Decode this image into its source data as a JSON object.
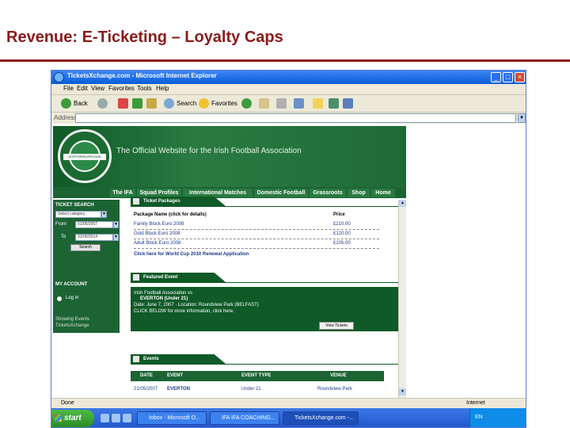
{
  "slide": {
    "title": "Revenue: E-Ticketing – Loyalty Caps"
  },
  "window": {
    "title": "TicketsXchange.com - Microsoft Internet Explorer",
    "buttons": [
      "_",
      "□",
      "×"
    ]
  },
  "menu": [
    "File",
    "Edit",
    "View",
    "Favorites",
    "Tools",
    "Help"
  ],
  "toolbar": {
    "back": "Back",
    "search": "Search",
    "favorites": "Favorites"
  },
  "address": {
    "label": "Address",
    "go": "▼"
  },
  "site": {
    "crest_text": "NORTHERN IRELAND",
    "hero_title": "The Official Website for the Irish Football Association",
    "nav": [
      "The IFA",
      "Squad Profiles",
      "International Matches",
      "Domestic Football",
      "Grassroots",
      "Shop",
      "Home"
    ]
  },
  "sidebar": {
    "ticket_search": "TICKET SEARCH",
    "category": "Select category",
    "from_label": "From",
    "from_value": "01/05/2007",
    "to_label": "To",
    "to_value": "31/05/2014",
    "search_btn": "Search",
    "my_account": "MY ACCOUNT",
    "login": "Log in",
    "footer1": "Showing Events",
    "footer2": "TicketsXchange"
  },
  "packages": {
    "header": "Ticket Packages",
    "col_name": "Package Name (click for details)",
    "col_price": "Price",
    "rows": [
      {
        "name": "Family Block Euro 2008",
        "price": "£210.00"
      },
      {
        "name": "Gold Block Euro 2008",
        "price": "£120.00"
      },
      {
        "name": "Adult Block Euro 2008",
        "price": "£105.00"
      }
    ],
    "link": "Click here for World Cup 2010 Renewal Application"
  },
  "featured": {
    "header": "Featured Event",
    "line1": "Irish Football Association vs",
    "line2": "EVERTON (Under 21)",
    "line3": "Date: June 7, 2007 · Location: Roundview Park (BELFAST)",
    "line4": "CLICK BELOW for more information, click here.",
    "button": "View Tickets"
  },
  "events": {
    "header": "Events",
    "columns": [
      "DATE",
      "EVENT",
      "EVENT TYPE",
      "VENUE"
    ],
    "rows": [
      {
        "date": "21/05/2007",
        "event": "EVERTON",
        "type": "Under 21",
        "venue": "Roundview Park"
      }
    ]
  },
  "status": {
    "left": "Done",
    "right": "Internet"
  },
  "taskbar": {
    "start": "start",
    "tasks": [
      "Inbox - Microsoft O...",
      "IFA IFA COACHING...",
      "TicketsXchange.com -..."
    ],
    "lang": "EN"
  }
}
